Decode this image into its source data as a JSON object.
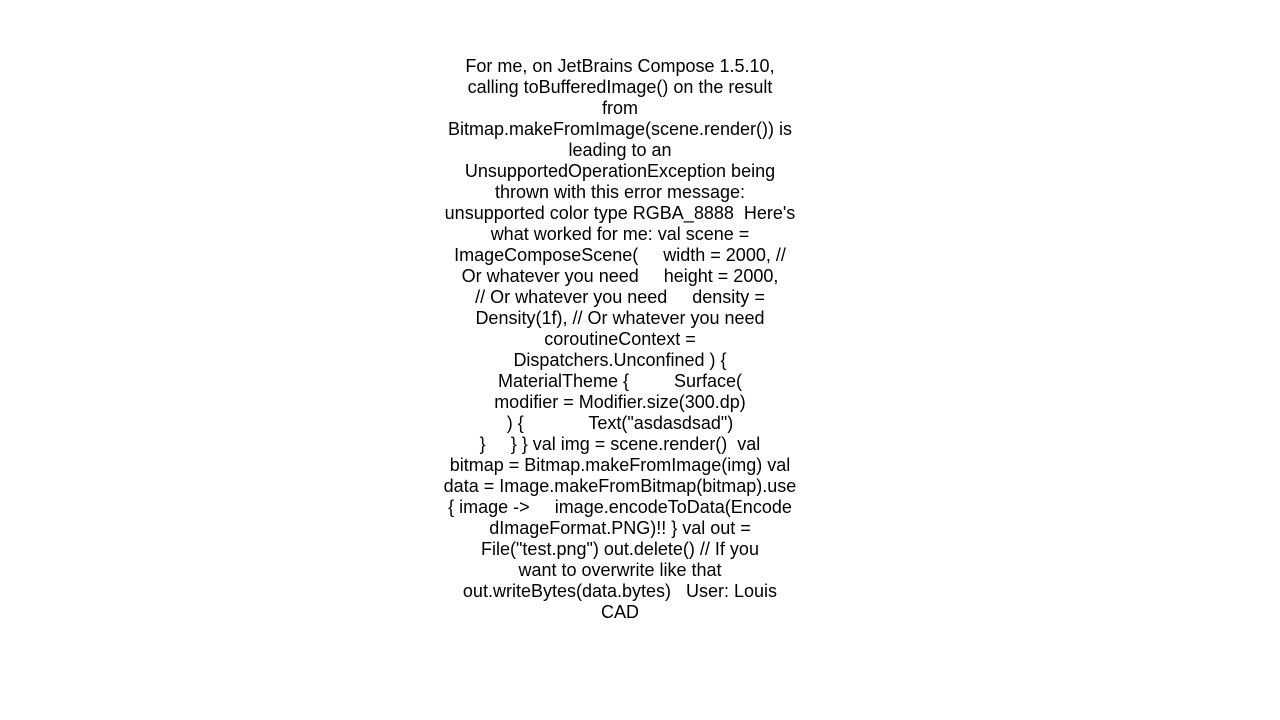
{
  "post": {
    "lines": [
      "For me, on JetBrains Compose 1.5.10,",
      "calling toBufferedImage() on the result",
      "from",
      "Bitmap.makeFromImage(scene.render()) is",
      "leading to an",
      "UnsupportedOperationException being",
      "thrown with this error message:",
      "unsupported color type RGBA_8888  Here's",
      "what worked for me: val scene =",
      "ImageComposeScene(     width = 2000, //",
      "Or whatever you need     height = 2000,",
      "// Or whatever you need     density =",
      "Density(1f), // Or whatever you need",
      "coroutineContext =",
      "Dispatchers.Unconfined ) {",
      "MaterialTheme {         Surface(",
      "modifier = Modifier.size(300.dp)",
      ") {             Text(\"asdasdsad\")",
      "}     } } val img = scene.render()  val",
      "bitmap = Bitmap.makeFromImage(img) val",
      "data = Image.makeFromBitmap(bitmap).use",
      "{ image ->     image.encodeToData(Encode",
      "dImageFormat.PNG)!! } val out =",
      "File(\"test.png\") out.delete() // If you",
      "want to overwrite like that",
      "out.writeBytes(data.bytes)   User: Louis",
      "CAD"
    ]
  }
}
